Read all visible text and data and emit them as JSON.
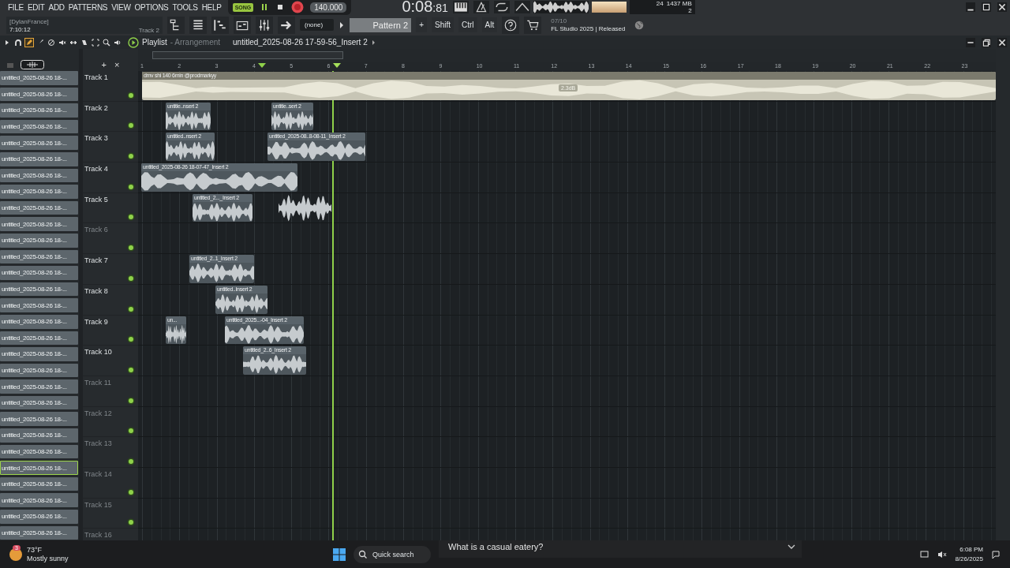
{
  "menu": [
    "FILE",
    "EDIT",
    "ADD",
    "PATTERNS",
    "VIEW",
    "OPTIONS",
    "TOOLS",
    "HELP"
  ],
  "transport": {
    "mode": "SONG",
    "tempo": "140.000",
    "time": "0:08",
    "time_fraction": ":81"
  },
  "monitor": {
    "cpu": "24",
    "memory": "1437 MB",
    "polyphony": "2"
  },
  "hint_panel": {
    "user": "[DylanFrance]",
    "time": "7:10:12",
    "target": "Track 2"
  },
  "pattern_bar": {
    "snap": "(none)",
    "pattern": "Pattern 2",
    "add": "+"
  },
  "modifier_keys": [
    "Shift",
    "Ctrl",
    "Alt"
  ],
  "news": {
    "date": "07/10",
    "text": "FL Studio 2025 | Released"
  },
  "playlist": {
    "title": "Playlist",
    "subtitle": "- Arrangement",
    "clip_source": "untitled_2025-08-26 17-59-56_Insert 2",
    "add": "+",
    "close": "×"
  },
  "ruler": [
    "1",
    "2",
    "3",
    "4",
    "5",
    "6",
    "7",
    "8",
    "9",
    "10",
    "11",
    "12",
    "13",
    "14",
    "15",
    "16",
    "17",
    "18",
    "19",
    "20",
    "21",
    "22",
    "23"
  ],
  "channels": [
    {
      "name": "untitled_2025-08-26 18-...",
      "selected": false
    },
    {
      "name": "untitled_2025-08-26 18-...",
      "selected": false
    },
    {
      "name": "untitled_2025-08-26 18-...",
      "selected": false
    },
    {
      "name": "untitled_2025-08-26 18-...",
      "selected": false
    },
    {
      "name": "untitled_2025-08-26 18-...",
      "selected": false
    },
    {
      "name": "untitled_2025-08-26 18-...",
      "selected": false
    },
    {
      "name": "untitled_2025-08-26 18-...",
      "selected": false
    },
    {
      "name": "untitled_2025-08-26 18-...",
      "selected": false
    },
    {
      "name": "untitled_2025-08-26 18-...",
      "selected": false
    },
    {
      "name": "untitled_2025-08-26 18-...",
      "selected": false
    },
    {
      "name": "untitled_2025-08-26 18-...",
      "selected": false
    },
    {
      "name": "untitled_2025-08-26 18-...",
      "selected": false
    },
    {
      "name": "untitled_2025-08-26 18-...",
      "selected": false
    },
    {
      "name": "untitled_2025-08-26 18-...",
      "selected": false
    },
    {
      "name": "untitled_2025-08-26 18-...",
      "selected": false
    },
    {
      "name": "untitled_2025-08-26 18-...",
      "selected": false
    },
    {
      "name": "untitled_2025-08-26 18-...",
      "selected": false
    },
    {
      "name": "untitled_2025-08-26 18-...",
      "selected": false
    },
    {
      "name": "untitled_2025-08-26 18-...",
      "selected": false
    },
    {
      "name": "untitled_2025-08-26 18-...",
      "selected": false
    },
    {
      "name": "untitled_2025-08-26 18-...",
      "selected": false
    },
    {
      "name": "untitled_2025-08-26 18-...",
      "selected": false
    },
    {
      "name": "untitled_2025-08-26 18-...",
      "selected": false
    },
    {
      "name": "untitled_2025-08-26 18-...",
      "selected": false
    },
    {
      "name": "untitled_2025-08-26 18-...",
      "selected": true
    },
    {
      "name": "untitled_2025-08-26 18-...",
      "selected": false
    },
    {
      "name": "untitled_2025-08-26 18-...",
      "selected": false
    },
    {
      "name": "untitled_2025-08-26 18-...",
      "selected": false
    },
    {
      "name": "untitled_2025-08-26 18-...",
      "selected": false
    }
  ],
  "tracks": [
    {
      "name": "Track 1",
      "clips": [
        {
          "kind": "labeled",
          "label": "dmv shi 140 6min @prodmarkyy",
          "gain": "2.3dB"
        }
      ]
    },
    {
      "name": "Track 2",
      "clips": [
        {
          "kind": "labeled",
          "label": "untitle..nsert 2"
        },
        {
          "kind": "labeled",
          "label": "untitle..sert 2"
        }
      ]
    },
    {
      "name": "Track 3",
      "clips": [
        {
          "kind": "labeled",
          "label": "untitled..nsert 2"
        },
        {
          "kind": "labeled",
          "label": "untitled_2025-08..8-08-11_Insert 2"
        }
      ]
    },
    {
      "name": "Track 4",
      "clips": [
        {
          "kind": "labeled",
          "label": "untitled_2025-08-26 18-07-47_Insert 2"
        }
      ]
    },
    {
      "name": "Track 5",
      "clips": [
        {
          "kind": "labeled",
          "label": "untitled_2..._Insert 2"
        },
        {
          "kind": "bare"
        }
      ]
    },
    {
      "name": "Track 6"
    },
    {
      "name": "Track 7",
      "clips": [
        {
          "kind": "labeled",
          "label": "untitled_2..1_Insert 2"
        }
      ]
    },
    {
      "name": "Track 8",
      "clips": [
        {
          "kind": "labeled",
          "label": "untitled..Insert 2"
        }
      ]
    },
    {
      "name": "Track 9",
      "clips": [
        {
          "kind": "labeled",
          "label": "un..."
        },
        {
          "kind": "labeled",
          "label": "untitled_2025...-04_Insert 2"
        }
      ]
    },
    {
      "name": "Track 10",
      "clips": [
        {
          "kind": "labeled",
          "label": "untitled_2..6_Insert 2"
        }
      ]
    },
    {
      "name": "Track 11"
    },
    {
      "name": "Track 12"
    },
    {
      "name": "Track 13"
    },
    {
      "name": "Track 14"
    },
    {
      "name": "Track 15"
    },
    {
      "name": "Track 16"
    }
  ],
  "taskbar": {
    "weather_badge": "3",
    "temperature": "73°F",
    "condition": "Mostly sunny",
    "search": "Quick search",
    "news": "What is a casual eatery?",
    "time": "6:08 PM",
    "date": "8/26/2025"
  }
}
